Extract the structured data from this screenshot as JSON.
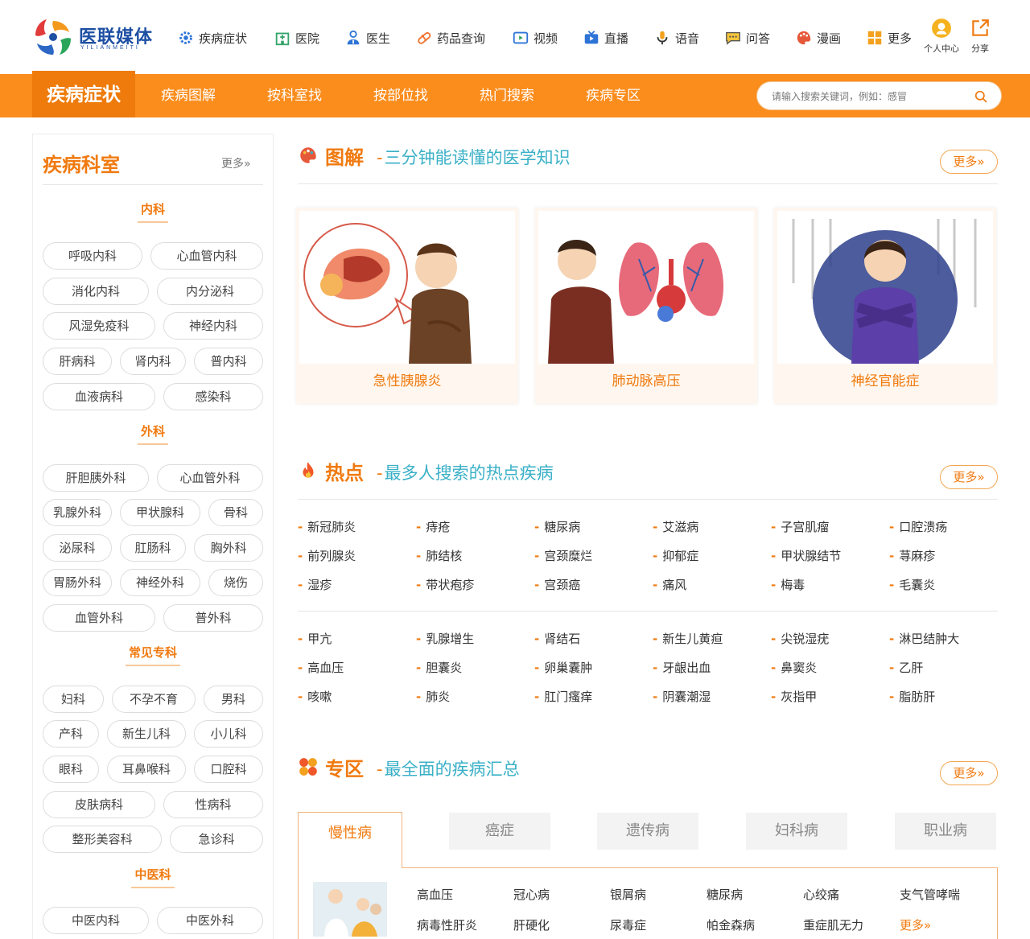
{
  "brand": {
    "name_cn": "医联媒体",
    "name_en": "YILIANMEITI"
  },
  "top_nav": [
    {
      "label": "疾病症状",
      "icon": "gear-icon"
    },
    {
      "label": "医院",
      "icon": "hospital-icon"
    },
    {
      "label": "医生",
      "icon": "doctor-icon"
    },
    {
      "label": "药品查询",
      "icon": "pill-icon"
    },
    {
      "label": "视频",
      "icon": "video-icon"
    },
    {
      "label": "直播",
      "icon": "live-icon"
    },
    {
      "label": "语音",
      "icon": "microphone-icon"
    },
    {
      "label": "问答",
      "icon": "chat-icon"
    },
    {
      "label": "漫画",
      "icon": "palette-icon"
    },
    {
      "label": "更多",
      "icon": "grid-icon"
    }
  ],
  "user": {
    "center": "个人中心",
    "share": "分享"
  },
  "main_nav": {
    "active": "疾病症状",
    "items": [
      "疾病图解",
      "按科室找",
      "按部位找",
      "热门搜索",
      "疾病专区"
    ]
  },
  "search": {
    "placeholder": "请输入搜索关键词，例如：感冒"
  },
  "sidebar": {
    "title": "疾病科室",
    "more": "更多»",
    "categories": [
      {
        "name": "内科",
        "items": [
          "呼吸内科",
          "心血管内科",
          "消化内科",
          "内分泌科",
          "风湿免疫科",
          "神经内科",
          "肝病科",
          "肾内科",
          "普内科",
          "血液病科",
          "感染科"
        ]
      },
      {
        "name": "外科",
        "items": [
          "肝胆胰外科",
          "心血管外科",
          "乳腺外科",
          "甲状腺科",
          "骨科",
          "泌尿科",
          "肛肠科",
          "胸外科",
          "胃肠外科",
          "神经外科",
          "烧伤",
          "血管外科",
          "普外科"
        ]
      },
      {
        "name": "常见专科",
        "items": [
          "妇科",
          "不孕不育",
          "男科",
          "产科",
          "新生儿科",
          "小儿科",
          "眼科",
          "耳鼻喉科",
          "口腔科",
          "皮肤病科",
          "性病科",
          "整形美容科",
          "急诊科"
        ]
      },
      {
        "name": "中医科",
        "items": [
          "中医内科",
          "中医外科"
        ]
      }
    ]
  },
  "sections": {
    "tujie": {
      "key": "图解",
      "sub": "三分钟能读懂的医学知识",
      "more": "更多»",
      "cards": [
        "急性胰腺炎",
        "肺动脉高压",
        "神经官能症"
      ]
    },
    "redian": {
      "key": "热点",
      "sub": "最多人搜索的热点疾病",
      "more": "更多»",
      "group1": [
        "新冠肺炎",
        "痔疮",
        "糖尿病",
        "艾滋病",
        "子宫肌瘤",
        "口腔溃疡",
        "前列腺炎",
        "肺结核",
        "宫颈糜烂",
        "抑郁症",
        "甲状腺结节",
        "荨麻疹",
        "湿疹",
        "带状疱疹",
        "宫颈癌",
        "痛风",
        "梅毒",
        "毛囊炎"
      ],
      "group2": [
        "甲亢",
        "乳腺增生",
        "肾结石",
        "新生儿黄疸",
        "尖锐湿疣",
        "淋巴结肿大",
        "高血压",
        "胆囊炎",
        "卵巢囊肿",
        "牙龈出血",
        "鼻窦炎",
        "乙肝",
        "咳嗽",
        "肺炎",
        "肛门瘙痒",
        "阴囊潮湿",
        "灰指甲",
        "脂肪肝"
      ]
    },
    "zhuanqu": {
      "key": "专区",
      "sub": "最全面的疾病汇总",
      "more": "更多»",
      "tabs": [
        "慢性病",
        "癌症",
        "遗传病",
        "妇科病",
        "职业病"
      ],
      "items": [
        "高血压",
        "冠心病",
        "银屑病",
        "糖尿病",
        "心绞痛",
        "支气管哮喘",
        "病毒性肝炎",
        "肝硬化",
        "尿毒症",
        "帕金森病",
        "重症肌无力"
      ],
      "items_more": "更多»"
    }
  },
  "colors": {
    "orange": "#fb8d1d",
    "orange_dark": "#ee7b0b",
    "text_orange": "#f07a10",
    "teal": "#3ab0c7"
  }
}
